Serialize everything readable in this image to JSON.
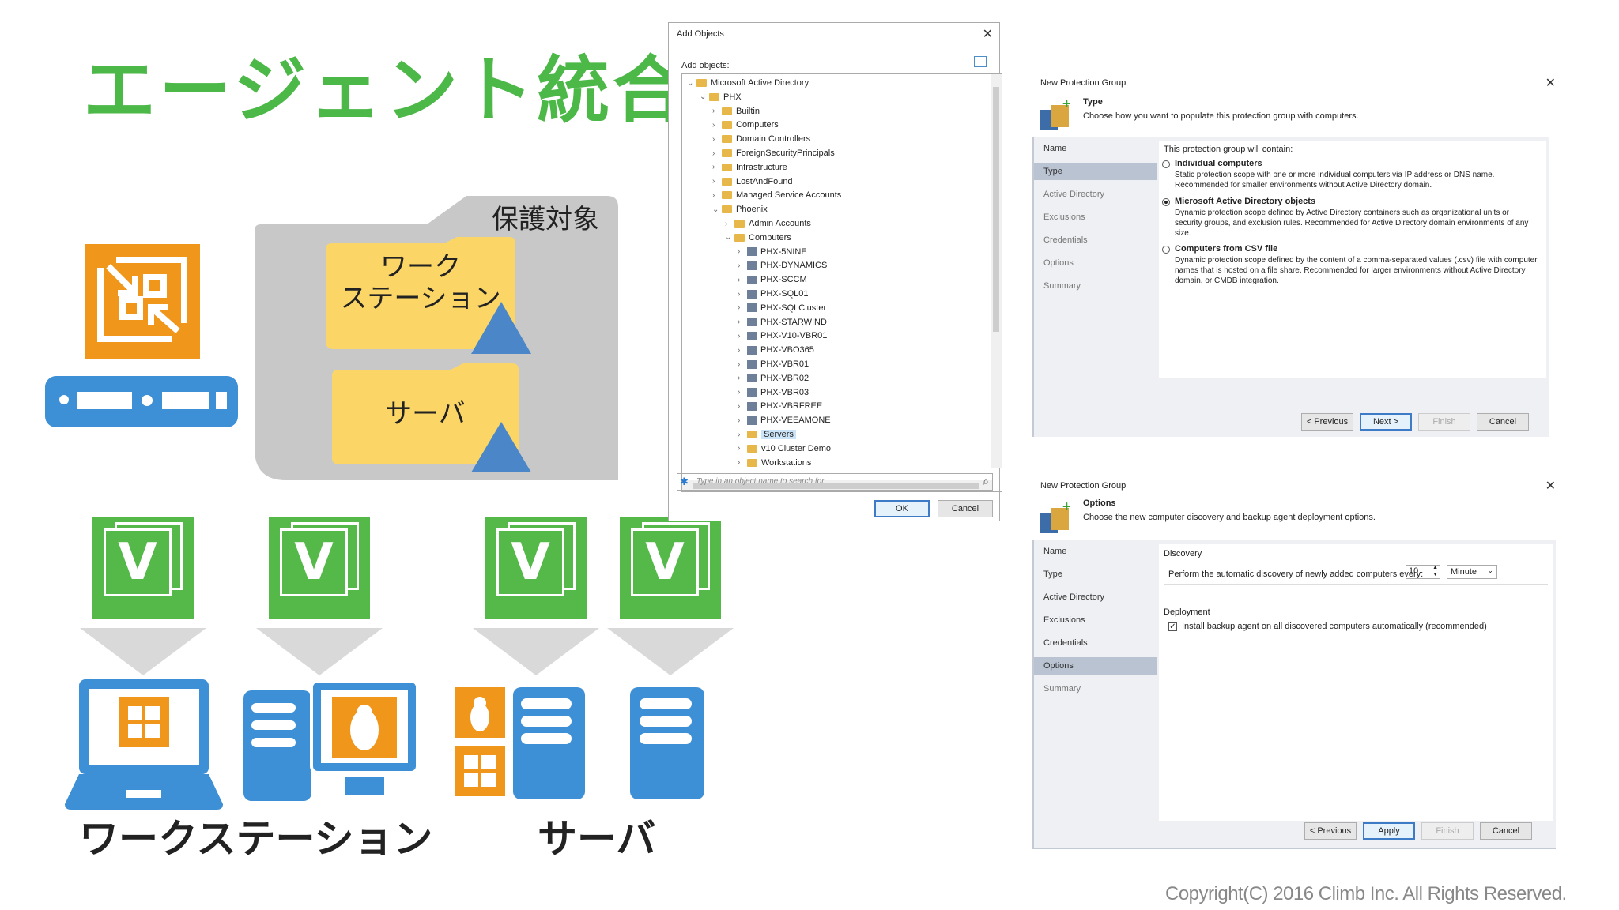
{
  "slide": {
    "title": "エージェント統合",
    "protect_label": "保護対象",
    "folder_workstation": "ワーク\nステーション",
    "folder_server": "サーバ",
    "bottom_workstation": "ワークステーション",
    "bottom_server": "サーバ",
    "v_letter": "V",
    "copyright": "Copyright(C) 2016 Climb Inc. All Rights Reserved."
  },
  "colors": {
    "green": "#4cb847",
    "orange": "#f0961b",
    "blue": "#3d8fd6",
    "folder": "#fbd667",
    "gray": "#c8c8c8",
    "triangle": "#4a86c8"
  },
  "add_objects": {
    "title": "Add Objects",
    "label": "Add objects:",
    "search_placeholder": "Type in an object name to search for",
    "ok": "OK",
    "cancel": "Cancel",
    "tree": [
      {
        "label": "Microsoft Active Directory",
        "depth": 0,
        "icon": "ad-icon",
        "expanded": true
      },
      {
        "label": "PHX",
        "depth": 1,
        "icon": "domain-icon",
        "expanded": true
      },
      {
        "label": "Builtin",
        "depth": 2,
        "icon": "folder-icon"
      },
      {
        "label": "Computers",
        "depth": 2,
        "icon": "folder-icon"
      },
      {
        "label": "Domain Controllers",
        "depth": 2,
        "icon": "folder-icon"
      },
      {
        "label": "ForeignSecurityPrincipals",
        "depth": 2,
        "icon": "folder-icon"
      },
      {
        "label": "Infrastructure",
        "depth": 2,
        "icon": "folder-icon"
      },
      {
        "label": "LostAndFound",
        "depth": 2,
        "icon": "folder-icon"
      },
      {
        "label": "Managed Service Accounts",
        "depth": 2,
        "icon": "folder-icon"
      },
      {
        "label": "Phoenix",
        "depth": 2,
        "icon": "folder-icon",
        "expanded": true
      },
      {
        "label": "Admin Accounts",
        "depth": 3,
        "icon": "folder-icon"
      },
      {
        "label": "Computers",
        "depth": 3,
        "icon": "folder-icon",
        "expanded": true
      },
      {
        "label": "PHX-5NINE",
        "depth": 4,
        "icon": "computer-icon"
      },
      {
        "label": "PHX-DYNAMICS",
        "depth": 4,
        "icon": "computer-icon"
      },
      {
        "label": "PHX-SCCM",
        "depth": 4,
        "icon": "computer-icon"
      },
      {
        "label": "PHX-SQL01",
        "depth": 4,
        "icon": "computer-icon"
      },
      {
        "label": "PHX-SQLCluster",
        "depth": 4,
        "icon": "computer-icon"
      },
      {
        "label": "PHX-STARWIND",
        "depth": 4,
        "icon": "computer-icon"
      },
      {
        "label": "PHX-V10-VBR01",
        "depth": 4,
        "icon": "computer-icon"
      },
      {
        "label": "PHX-VBO365",
        "depth": 4,
        "icon": "computer-icon"
      },
      {
        "label": "PHX-VBR01",
        "depth": 4,
        "icon": "computer-icon"
      },
      {
        "label": "PHX-VBR02",
        "depth": 4,
        "icon": "computer-icon"
      },
      {
        "label": "PHX-VBR03",
        "depth": 4,
        "icon": "computer-icon"
      },
      {
        "label": "PHX-VBRFREE",
        "depth": 4,
        "icon": "computer-icon"
      },
      {
        "label": "PHX-VEEAMONE",
        "depth": 4,
        "icon": "computer-icon"
      },
      {
        "label": "Servers",
        "depth": 4,
        "icon": "folder-icon",
        "selected": true
      },
      {
        "label": "v10 Cluster Demo",
        "depth": 4,
        "icon": "folder-icon"
      },
      {
        "label": "Workstations",
        "depth": 4,
        "icon": "folder-icon"
      }
    ]
  },
  "npg_type": {
    "window_title": "New Protection Group",
    "heading": "Type",
    "subheading": "Choose how you want to populate this protection group with computers.",
    "nav": [
      "Name",
      "Type",
      "Active Directory",
      "Exclusions",
      "Credentials",
      "Options",
      "Summary"
    ],
    "intro": "This protection group will contain:",
    "options": [
      {
        "title": "Individual computers",
        "desc": "Static protection scope with one or more individual computers via IP address or DNS name. Recommended for smaller environments without Active Directory domain.",
        "selected": false
      },
      {
        "title": "Microsoft Active Directory objects",
        "desc": "Dynamic protection scope defined by Active Directory containers such as organizational units or security groups, and exclusion rules. Recommended for Active Directory domain environments of any size.",
        "selected": true
      },
      {
        "title": "Computers from CSV file",
        "desc": "Dynamic protection scope defined by the content of a comma-separated values (.csv) file with computer names that is hosted on a file share. Recommended for larger environments without Active Directory domain, or CMDB integration.",
        "selected": false
      }
    ],
    "buttons": {
      "previous": "< Previous",
      "next": "Next >",
      "finish": "Finish",
      "cancel": "Cancel"
    }
  },
  "npg_options": {
    "window_title": "New Protection Group",
    "heading": "Options",
    "subheading": "Choose the new computer discovery and backup agent deployment options.",
    "nav": [
      "Name",
      "Type",
      "Active Directory",
      "Exclusions",
      "Credentials",
      "Options",
      "Summary"
    ],
    "discovery_title": "Discovery",
    "discovery_label": "Perform the automatic discovery of newly added computers every:",
    "discovery_value": "10",
    "discovery_unit": "Minute",
    "deployment_title": "Deployment",
    "deployment_checkbox": "Install backup agent on all discovered computers automatically (recommended)",
    "deployment_checked": true,
    "buttons": {
      "previous": "< Previous",
      "apply": "Apply",
      "finish": "Finish",
      "cancel": "Cancel"
    }
  }
}
